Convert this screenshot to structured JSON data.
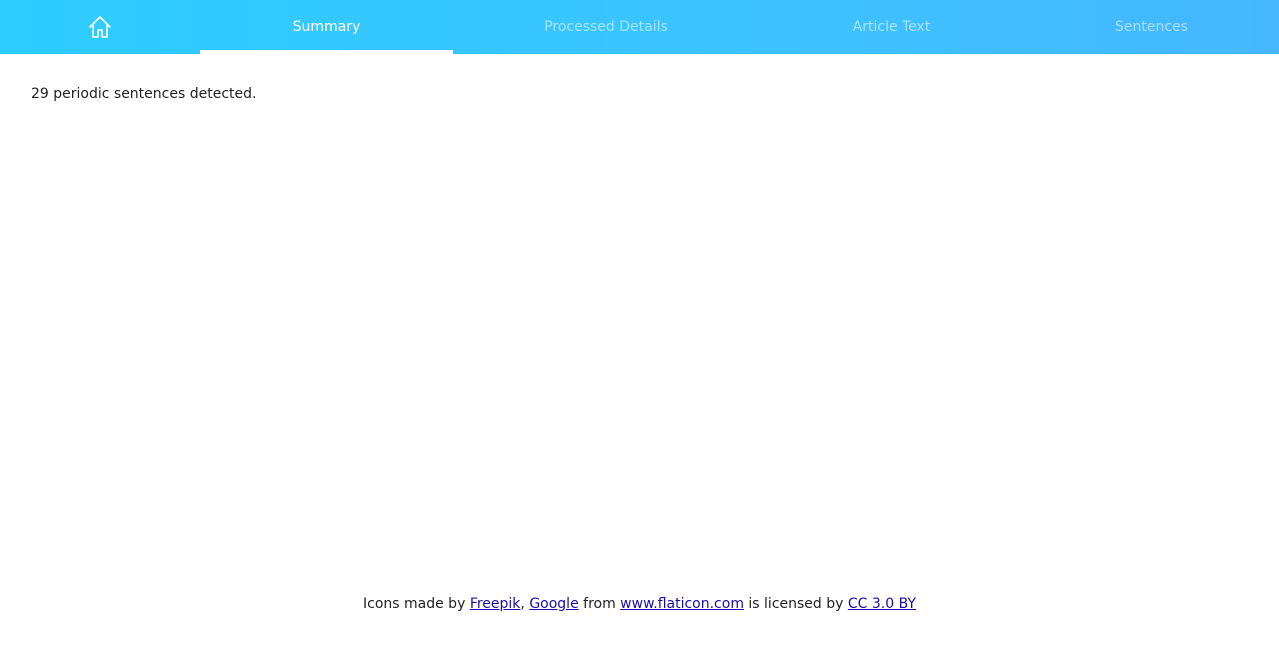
{
  "nav": {
    "home_icon": "home-icon",
    "tabs": [
      {
        "label": "Summary",
        "active": true
      },
      {
        "label": "Processed Details",
        "active": false
      },
      {
        "label": "Article Text",
        "active": false
      },
      {
        "label": "Sentences",
        "active": false
      }
    ]
  },
  "main": {
    "summary_text": "29 periodic sentences detected."
  },
  "footer": {
    "prefix": "Icons made by ",
    "link1": "Freepik",
    "sep1": ", ",
    "link2": "Google",
    "mid": " from ",
    "link3": "www.flaticon.com",
    "mid2": " is licensed by ",
    "link4": "CC 3.0 BY"
  },
  "colors": {
    "nav_gradient_start": "#2ccdff",
    "nav_gradient_end": "#45b6ff",
    "link": "#1a0dab"
  }
}
